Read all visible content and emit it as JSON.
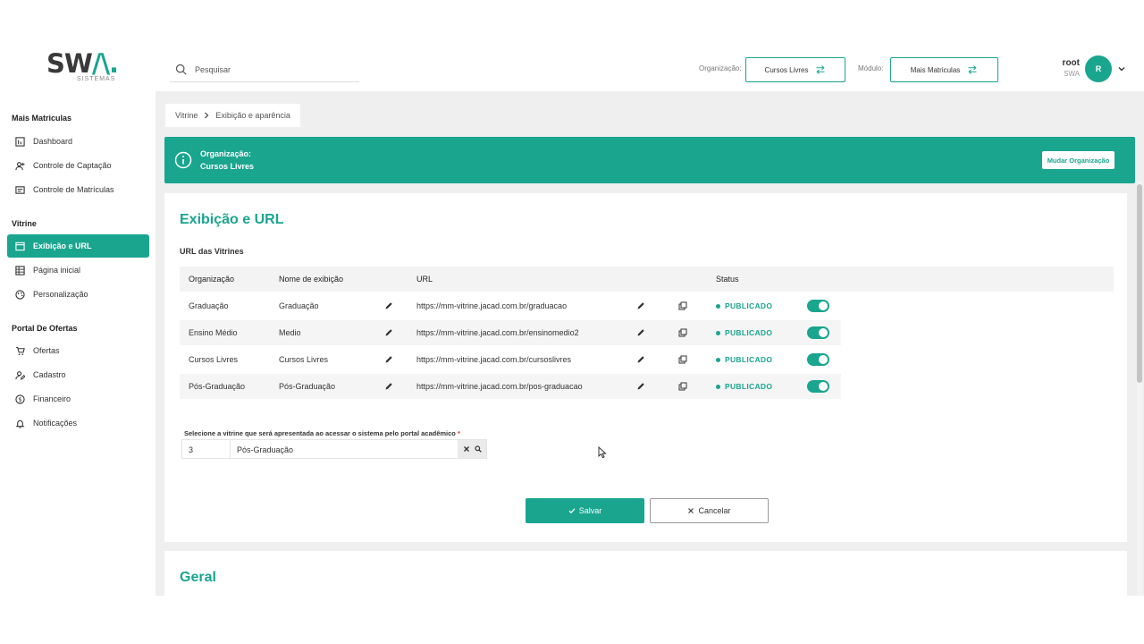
{
  "header": {
    "logo_text": "SWA.",
    "logo_sub": "SISTEMAS",
    "search_placeholder": "Pesquisar",
    "org_label": "Organização:",
    "org_value": "Cursos Livres",
    "module_label": "Módulo:",
    "module_value": "Mais Matriculas",
    "user_name": "root",
    "user_org": "SWA",
    "avatar_initial": "R"
  },
  "sidebar": {
    "sections": [
      {
        "title": "Mais Matriculas",
        "items": [
          "Dashboard",
          "Controle de Captação",
          "Controle de Matrículas"
        ]
      },
      {
        "title": "Vitrine",
        "items": [
          "Exibição e URL",
          "Página inicial",
          "Personalização"
        ]
      },
      {
        "title": "Portal De Ofertas",
        "items": [
          "Ofertas",
          "Cadastro",
          "Financeiro",
          "Notificações"
        ]
      }
    ],
    "active_item": "Exibição e URL"
  },
  "breadcrumb": [
    "Vitrine",
    "Exibição e aparência"
  ],
  "org_banner": {
    "label": "Organização:",
    "value": "Cursos Livres",
    "button": "Mudar Organização"
  },
  "section": {
    "title": "Exibição e URL",
    "subtitle": "URL das Vitrines",
    "table": {
      "headers": [
        "Organização",
        "Nome de exibição",
        "URL",
        "Status"
      ],
      "rows": [
        {
          "org": "Graduação",
          "name": "Graduação",
          "url": "https://mm-vitrine.jacad.com.br/graduacao",
          "status": "PUBLICADO"
        },
        {
          "org": "Ensino Médio",
          "name": "Medio",
          "url": "https://mm-vitrine.jacad.com.br/ensinomedio2",
          "status": "PUBLICADO"
        },
        {
          "org": "Cursos Livres",
          "name": "Cursos Livres",
          "url": "https://mm-vitrine.jacad.com.br/cursoslivres",
          "status": "PUBLICADO"
        },
        {
          "org": "Pós-Graduação",
          "name": "Pós-Graduação",
          "url": "https://mm-vitrine.jacad.com.br/pos-graduacao",
          "status": "PUBLICADO"
        }
      ]
    },
    "select_label": "Selecione a vitrine que será apresentada ao acessar o sistema pelo portal acadêmico",
    "select_required": "*",
    "select_code": "3",
    "select_value": "Pós-Graduação",
    "save_label": "Salvar",
    "cancel_label": "Cancelar"
  },
  "section2": {
    "title": "Geral"
  },
  "colors": {
    "accent": "#1aa58f",
    "background": "#efefef"
  }
}
